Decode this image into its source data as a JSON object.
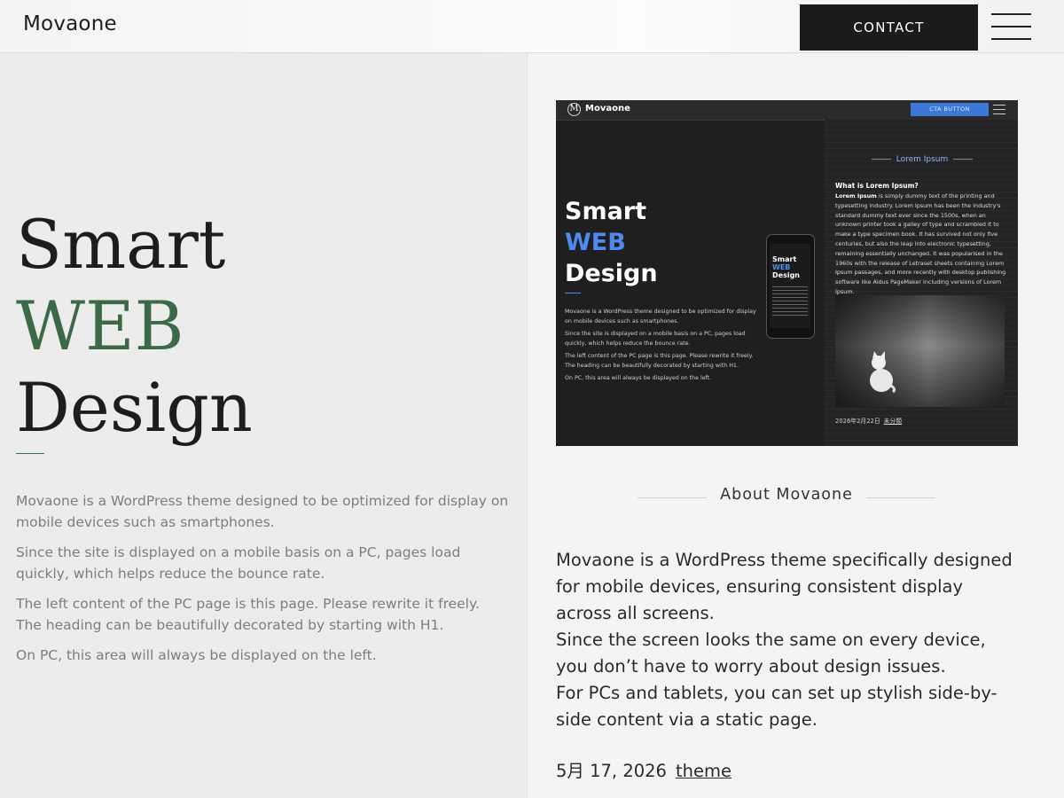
{
  "header": {
    "logo": "Movaone",
    "contact_label": "CONTACT"
  },
  "hero": {
    "title_line1": "Smart",
    "title_line2": "WEB",
    "title_line3": "Design",
    "paragraphs": [
      "Movaone is a WordPress theme designed to be optimized for display on mobile devices such as smartphones.",
      "Since the site is displayed on a mobile basis on a PC, pages load quickly, which helps reduce the bounce rate.",
      "The left content of the PC page is this page. Please rewrite it freely. The heading can be beautifully decorated by starting with H1.",
      "On PC, this area will always be displayed on the left."
    ],
    "accent_color": "#3a6a46"
  },
  "thumbnail": {
    "logo": "Movaone",
    "cta": "CTA BUTTON",
    "title_line1": "Smart",
    "title_line2": "WEB",
    "title_line3": "Design",
    "paragraphs": [
      "Movaone is a WordPress theme designed to be optimized for display on mobile devices such as smartphones.",
      "Since the site is displayed on a mobile basis on a PC, pages load quickly, which helps reduce the bounce rate.",
      "The left content of the PC page is this page. Please rewrite it freely. The heading can be beautifully decorated by starting with H1.",
      "On PC, this area will always be displayed on the left."
    ],
    "phone_title_line1": "Smart",
    "phone_title_line2": "WEB",
    "phone_title_line3": "Design",
    "section_head": "Lorem Ipsum",
    "question": "What is Lorem Ipsum?",
    "body_lead": "Lorem Ipsum",
    "body_rest": " is simply dummy text of the printing and typesetting industry. Lorem Ipsum has been the industry's standard dummy text ever since the 1500s, when an unknown printer took a galley of type and scrambled it to make a type specimen book. It has survived not only five centuries, but also the leap into electronic typesetting, remaining essentially unchanged. It was popularised in the 1960s with the release of Letraset sheets containing Lorem Ipsum passages, and more recently with desktop publishing software like Aldus PageMaker including versions of Lorem Ipsum.",
    "date": "2026年2月22日",
    "category": "未分類",
    "accent_color": "#4d8bf0"
  },
  "about": {
    "heading": "About Movaone",
    "lines": [
      "Movaone is a WordPress theme specifically designed",
      "for mobile devices, ensuring consistent display",
      "across all screens.",
      "Since the screen looks the same on every device,",
      "you don’t have to worry about design issues.",
      "For PCs and tablets, you can set up stylish side-by-",
      "side content via a static page."
    ],
    "date": "5月 17, 2026",
    "tag": "theme"
  }
}
